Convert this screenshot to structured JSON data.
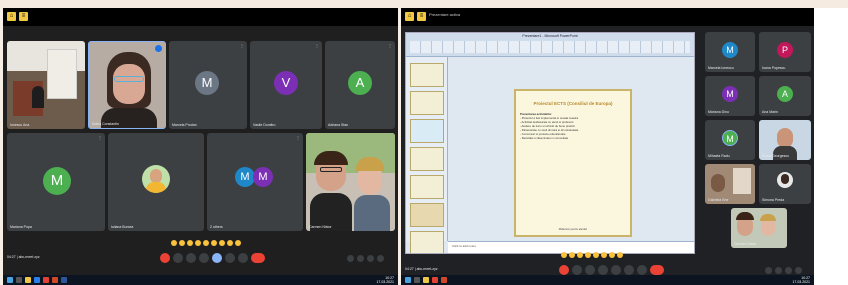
{
  "colors": {
    "meet_tile": "#3c4043",
    "meet_bg": "#202124",
    "avatar_teal": "#1e88c9",
    "avatar_purple": "#7b2fb5",
    "avatar_green": "#4caf50",
    "end_call": "#ea4335",
    "bezel_button": "#f2c744"
  },
  "left_screen": {
    "tiles": [
      {
        "name": "Ionescu Ana",
        "type": "photo-classroom"
      },
      {
        "name": "Doina Constantin",
        "type": "photo-woman-glasses"
      },
      {
        "name": "Marcela Prodan",
        "type": "avatar",
        "letter": "M",
        "color": "#6b7785"
      },
      {
        "name": "Vasile Dumitru",
        "type": "avatar",
        "letter": "V",
        "color": "#7b2fb5"
      },
      {
        "name": "Adriana Stan",
        "type": "avatar",
        "letter": "A",
        "color": "#4caf50"
      },
      {
        "name": "Mariana Popa",
        "type": "avatar",
        "letter": "M",
        "color": "#4caf50"
      },
      {
        "name": "Iuliana Burcea",
        "type": "photo-profile"
      },
      {
        "name": "2 others",
        "type": "group-avatar",
        "letters": [
          "M",
          "M"
        ]
      },
      {
        "name": "Carmen Nistor",
        "type": "photo-two-women"
      }
    ],
    "meeting_code": "04:27 | abc-meet-xyz",
    "clock_time": "10:27",
    "clock_date": "17.03.2021"
  },
  "right_screen": {
    "ppt_window_title": "Prezentare1 - Microsoft PowerPoint",
    "presenter_label": "Prezentare activa",
    "slide": {
      "title": "Proiectul ECTS (Consiliul de Europa)",
      "body_lines": [
        "Prezentarea activitatilor",
        "- Proiectul a fost implementat in scoala noastra",
        "- Activitati desfasurate cu elevii si profesorii",
        "- Ateliere de lucru si schimb de bune practici",
        "- Parteneriate cu scoli din tara si din strainatate",
        "- Concursuri si proiecte educationale",
        "- Rezultate si diseminare in comunitate"
      ],
      "footer": "Multumim pentru atentie!"
    },
    "notes_placeholder": "Click to add notes",
    "tiles": [
      {
        "name": "Marcela Ionescu",
        "type": "avatar",
        "letter": "M",
        "color": "#1e88c9"
      },
      {
        "name": "Ioana Popescu",
        "type": "avatar",
        "letter": "P",
        "color": "#c2185b"
      },
      {
        "name": "Mariana Dinu",
        "type": "avatar",
        "letter": "M",
        "color": "#7b2fb5"
      },
      {
        "name": "Ana Marin",
        "type": "avatar",
        "letter": "A",
        "color": "#4caf50"
      },
      {
        "name": "Mihaela Radu",
        "type": "avatar",
        "letter": "M",
        "color": "#4caf50"
      },
      {
        "name": "Elena Georgescu",
        "type": "photo-woman"
      },
      {
        "name": "Gabriela Ene",
        "type": "photo-woman-room"
      },
      {
        "name": "Simona Preda",
        "type": "photo-profile"
      },
      {
        "name": "Carmen Nistor",
        "type": "photo-two-women"
      }
    ],
    "meeting_code": "04:27 | abc-meet-xyz",
    "clock_time": "10:27",
    "clock_date": "17.03.2021"
  }
}
